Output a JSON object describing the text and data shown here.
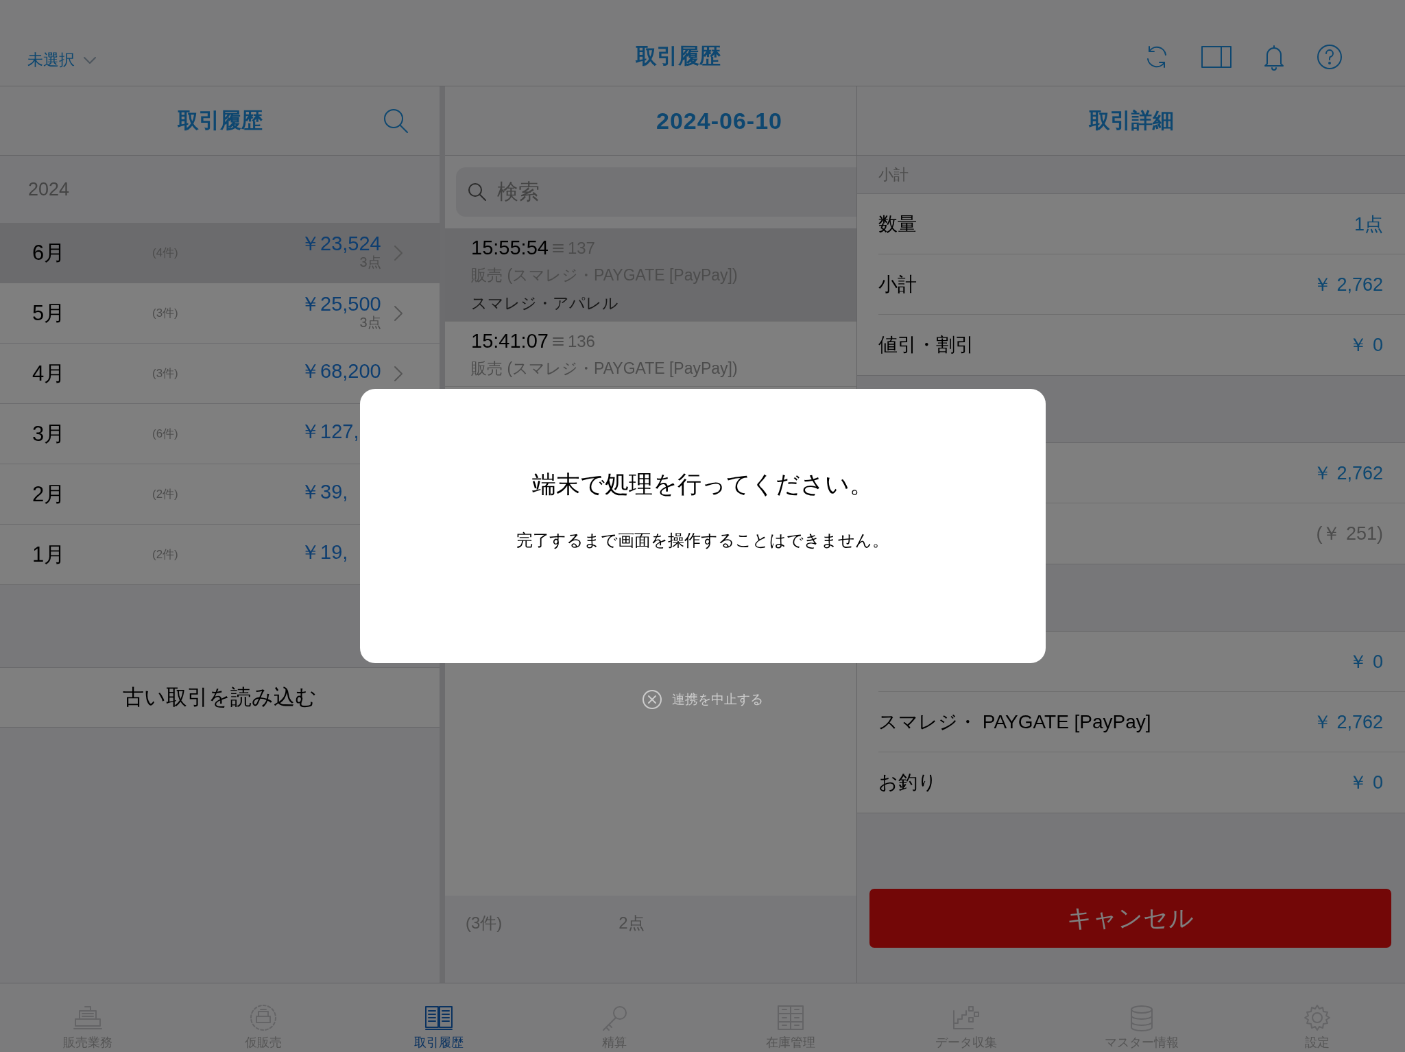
{
  "top_bar": {
    "store_selector": "未選択",
    "title": "取引履歴"
  },
  "history_panel": {
    "title": "取引履歴",
    "year": "2024",
    "months": [
      {
        "label": "6月",
        "count": "(4件)",
        "amount": "￥23,524",
        "points": "3点",
        "chevron": true,
        "selected": true
      },
      {
        "label": "5月",
        "count": "(3件)",
        "amount": "￥25,500",
        "points": "3点",
        "chevron": true,
        "selected": false
      },
      {
        "label": "4月",
        "count": "(3件)",
        "amount": "￥68,200",
        "chevron": true,
        "selected": false
      },
      {
        "label": "3月",
        "count": "(6件)",
        "amount": "￥127,",
        "chevron": false,
        "selected": false
      },
      {
        "label": "2月",
        "count": "(2件)",
        "amount": "￥39,",
        "chevron": false,
        "selected": false
      },
      {
        "label": "1月",
        "count": "(2件)",
        "amount": "￥19,",
        "chevron": false,
        "selected": false
      }
    ],
    "load_more": "古い取引を読み込む"
  },
  "day_panel": {
    "title": "2024-06-10",
    "search": {
      "placeholder": "検索"
    },
    "transactions": [
      {
        "time": "15:55:54",
        "number": "137",
        "type": "販売 (スマレジ・PAYGATE [PayPay])",
        "store": "スマレジ・アパレル",
        "selected": true
      },
      {
        "time": "15:41:07",
        "number": "136",
        "type": "販売 (スマレジ・PAYGATE [PayPay])",
        "selected": false
      }
    ],
    "footer": {
      "count": "(3件)",
      "points": "2点"
    }
  },
  "detail_panel": {
    "title": "取引詳細",
    "sections": [
      {
        "header": "小計",
        "rows": [
          {
            "label": "数量",
            "value": "1点",
            "kind": "amount"
          },
          {
            "label": "小計",
            "value": "￥ 2,762",
            "kind": "amount"
          },
          {
            "label": "値引・割引",
            "value": "￥ 0",
            "kind": "amount"
          }
        ]
      },
      {
        "rows": [
          {
            "value": "￥ 2,762",
            "kind": "amount"
          },
          {
            "value": "(￥ 251)",
            "kind": "muted"
          }
        ]
      },
      {
        "rows": [
          {
            "value": "￥ 0",
            "kind": "amount"
          },
          {
            "label": "スマレジ・ PAYGATE [PayPay]",
            "value": "￥ 2,762",
            "kind": "amount"
          },
          {
            "label": "お釣り",
            "value": "￥ 0",
            "kind": "amount"
          }
        ]
      }
    ],
    "cancel_button": "キャンセル"
  },
  "dialog": {
    "title": "端末で処理を行ってください。",
    "message": "完了するまで画面を操作することはできません。",
    "cancel_link": "連携を中止する"
  },
  "tab_bar": [
    {
      "label": "販売業務",
      "selected": false
    },
    {
      "label": "仮販売",
      "selected": false
    },
    {
      "label": "取引履歴",
      "selected": true
    },
    {
      "label": "精算",
      "selected": false
    },
    {
      "label": "在庫管理",
      "selected": false
    },
    {
      "label": "データ収集",
      "selected": false
    },
    {
      "label": "マスター情報",
      "selected": false
    },
    {
      "label": "設定",
      "selected": false
    }
  ]
}
